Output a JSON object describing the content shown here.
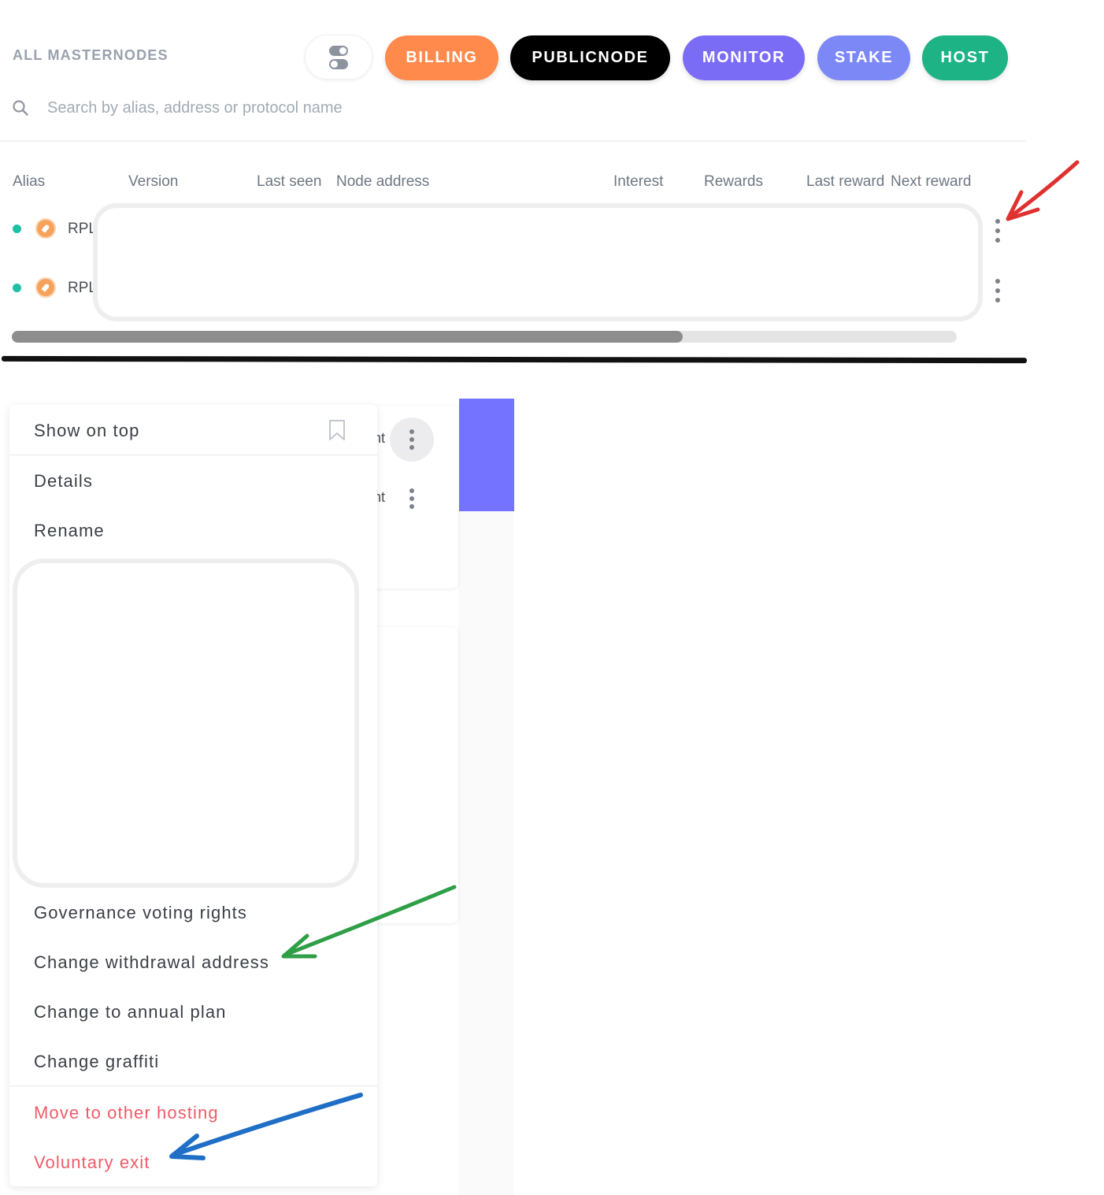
{
  "header": {
    "section_title": "ALL MASTERNODES",
    "buttons": [
      {
        "label": "BILLING",
        "color": "#ff8a4c"
      },
      {
        "label": "PUBLICNODE",
        "color": "#000000"
      },
      {
        "label": "MONITOR",
        "color": "#7b6cf6"
      },
      {
        "label": "STAKE",
        "color": "#7d88f7"
      },
      {
        "label": "HOST",
        "color": "#1db384"
      }
    ]
  },
  "search": {
    "placeholder": "Search by alias, address or protocol name",
    "value": ""
  },
  "table": {
    "columns": [
      "Alias",
      "Version",
      "Last seen",
      "Node address",
      "Interest",
      "Rewards",
      "Last reward",
      "Next reward"
    ],
    "rows": [
      {
        "alias": "RPL",
        "status": "online",
        "icon": "rocketpool-icon"
      },
      {
        "alias": "RPL",
        "status": "online",
        "icon": "rocketpool-icon"
      }
    ]
  },
  "context_menu": {
    "items": [
      {
        "label": "Show on top"
      },
      {
        "label": "Details"
      },
      {
        "label": "Rename"
      },
      {
        "label": "Governance voting rights"
      },
      {
        "label": "Change withdrawal address"
      },
      {
        "label": "Change to annual plan"
      },
      {
        "label": "Change graffiti"
      }
    ],
    "danger_items": [
      {
        "label": "Move to other hosting"
      },
      {
        "label": "Voluntary exit"
      }
    ]
  },
  "background_fragments": [
    "nt",
    "nt"
  ],
  "annotation_colors": {
    "red_arrow": "#e03030",
    "green_arrow": "#2e9e47",
    "blue_arrow": "#1f6fc7"
  }
}
